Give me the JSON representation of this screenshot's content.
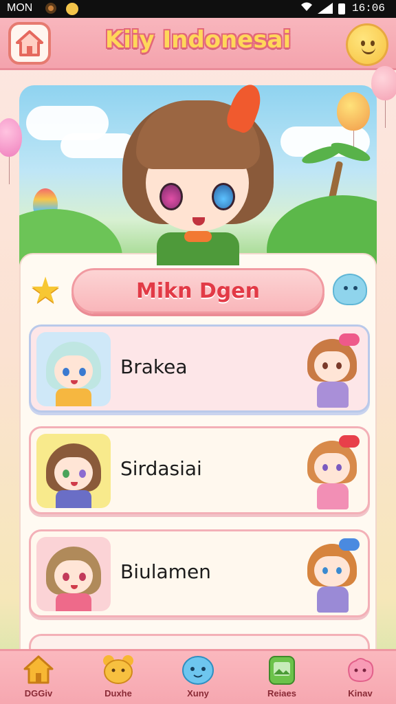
{
  "status_bar": {
    "carrier": "MON",
    "time": "16:06"
  },
  "header": {
    "title": "Kiiy Indonesai"
  },
  "profile": {
    "name": "Mikn Dgen"
  },
  "list": {
    "items": [
      {
        "label": "Brakea"
      },
      {
        "label": "Sirdasiai"
      },
      {
        "label": "Biulamen"
      }
    ]
  },
  "bottom_nav": {
    "items": [
      {
        "label": "DGGiv",
        "icon": "house-icon"
      },
      {
        "label": "Duxhe",
        "icon": "bear-icon"
      },
      {
        "label": "Xuny",
        "icon": "blob-face-icon"
      },
      {
        "label": "Reiaes",
        "icon": "tablet-icon"
      },
      {
        "label": "Kinav",
        "icon": "pink-blob-icon"
      }
    ]
  },
  "colors": {
    "header_bg": "#f4a3ad",
    "title_fill": "#ffd75a",
    "name_text": "#e23a46",
    "nav_bg": "#f6a7b0"
  }
}
